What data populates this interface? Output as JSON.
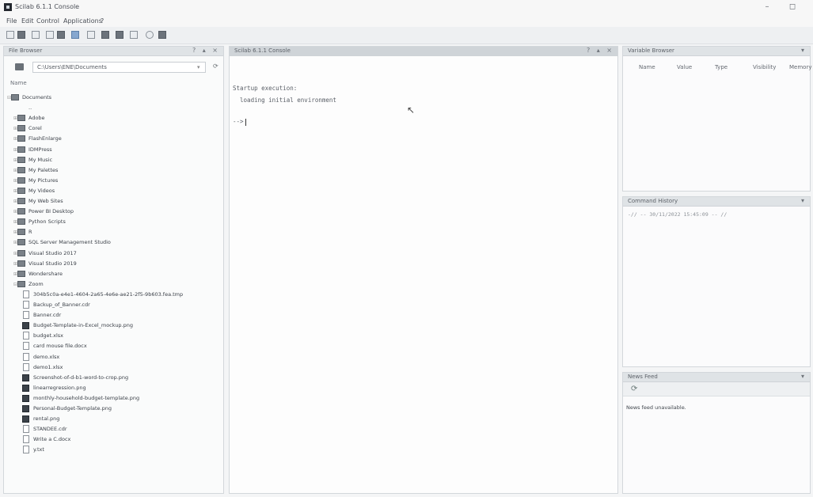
{
  "window": {
    "title": "Scilab 6.1.1 Console",
    "minimize": "–",
    "maximize": "◻"
  },
  "menubar": {
    "file": "File",
    "edit": "Edit",
    "control": "Control",
    "applications": "Applications",
    "help": "?"
  },
  "file_browser": {
    "title": "File Browser",
    "controls": "? ▴ ×",
    "path": "C:\\Users\\ENE\\Documents",
    "column_name": "Name",
    "items": [
      {
        "label": "Documents",
        "icon": "folder-icon",
        "expander": "⊟"
      },
      {
        "label": "..",
        "icon": "up-icon",
        "expander": ""
      },
      {
        "label": "Adobe",
        "icon": "folder-icon",
        "expander": "⊞"
      },
      {
        "label": "Corel",
        "icon": "folder-icon",
        "expander": "⊞"
      },
      {
        "label": "FlashEnlarge",
        "icon": "folder-icon",
        "expander": "⊞"
      },
      {
        "label": "IDMPress",
        "icon": "folder-icon",
        "expander": "⊞"
      },
      {
        "label": "My Music",
        "icon": "folder-icon",
        "expander": "⊞"
      },
      {
        "label": "My Palettes",
        "icon": "folder-icon",
        "expander": "⊞"
      },
      {
        "label": "My Pictures",
        "icon": "folder-icon",
        "expander": "⊞"
      },
      {
        "label": "My Videos",
        "icon": "folder-icon",
        "expander": "⊞"
      },
      {
        "label": "My Web Sites",
        "icon": "folder-icon",
        "expander": "⊞"
      },
      {
        "label": "Power BI Desktop",
        "icon": "folder-icon",
        "expander": "⊞"
      },
      {
        "label": "Python Scripts",
        "icon": "folder-icon",
        "expander": "⊞"
      },
      {
        "label": "R",
        "icon": "folder-icon",
        "expander": "⊞"
      },
      {
        "label": "SQL Server Management Studio",
        "icon": "folder-icon",
        "expander": "⊞"
      },
      {
        "label": "Visual Studio 2017",
        "icon": "folder-icon",
        "expander": "⊞"
      },
      {
        "label": "Visual Studio 2019",
        "icon": "folder-icon",
        "expander": "⊞"
      },
      {
        "label": "Wondershare",
        "icon": "folder-icon",
        "expander": "⊞"
      },
      {
        "label": "Zoom",
        "icon": "folder-icon",
        "expander": "⊟"
      },
      {
        "label": "304b5c0a-e4e1-4604-2a65-4e6e-ae21-2f5-9b603.fea.tmp",
        "icon": "file-icon",
        "expander": ""
      },
      {
        "label": "Backup_of_Banner.cdr",
        "icon": "file-icon",
        "expander": ""
      },
      {
        "label": "Banner.cdr",
        "icon": "file-icon",
        "expander": ""
      },
      {
        "label": "Budget-Template-in-Excel_mockup.png",
        "icon": "image-icon",
        "expander": ""
      },
      {
        "label": "budget.xlsx",
        "icon": "file-icon",
        "expander": ""
      },
      {
        "label": "card mouse file.docx",
        "icon": "file-icon",
        "expander": ""
      },
      {
        "label": "demo.xlsx",
        "icon": "file-icon",
        "expander": ""
      },
      {
        "label": "demo1.xlsx",
        "icon": "file-icon",
        "expander": ""
      },
      {
        "label": "Screenshot-of-d-b1-word-to-crop.png",
        "icon": "image-icon",
        "expander": ""
      },
      {
        "label": "linearregression.png",
        "icon": "image-icon",
        "expander": ""
      },
      {
        "label": "monthly-household-budget-template.png",
        "icon": "image-icon",
        "expander": ""
      },
      {
        "label": "Personal-Budget-Template.png",
        "icon": "image-icon",
        "expander": ""
      },
      {
        "label": "rental.png",
        "icon": "image-icon",
        "expander": ""
      },
      {
        "label": "STANDEE.cdr",
        "icon": "file-icon",
        "expander": ""
      },
      {
        "label": "Write a C.docx",
        "icon": "file-icon",
        "expander": ""
      },
      {
        "label": "y.txt",
        "icon": "file-icon",
        "expander": ""
      }
    ]
  },
  "console": {
    "title": "Scilab 6.1.1 Console",
    "controls": "? ▴ ×",
    "lines": [
      "Startup execution:",
      "  loading initial environment"
    ],
    "prompt": "-->"
  },
  "variable_browser": {
    "title": "Variable Browser",
    "controls": "▾",
    "columns": [
      "Name",
      "Value",
      "Type",
      "Visibility",
      "Memory"
    ]
  },
  "command_history": {
    "title": "Command History",
    "controls": "▾",
    "items": [
      "-// -- 30/11/2022 15:45:09 -- //"
    ]
  },
  "news_feed": {
    "title": "News Feed",
    "controls": "▾",
    "message": "News feed unavailable."
  }
}
